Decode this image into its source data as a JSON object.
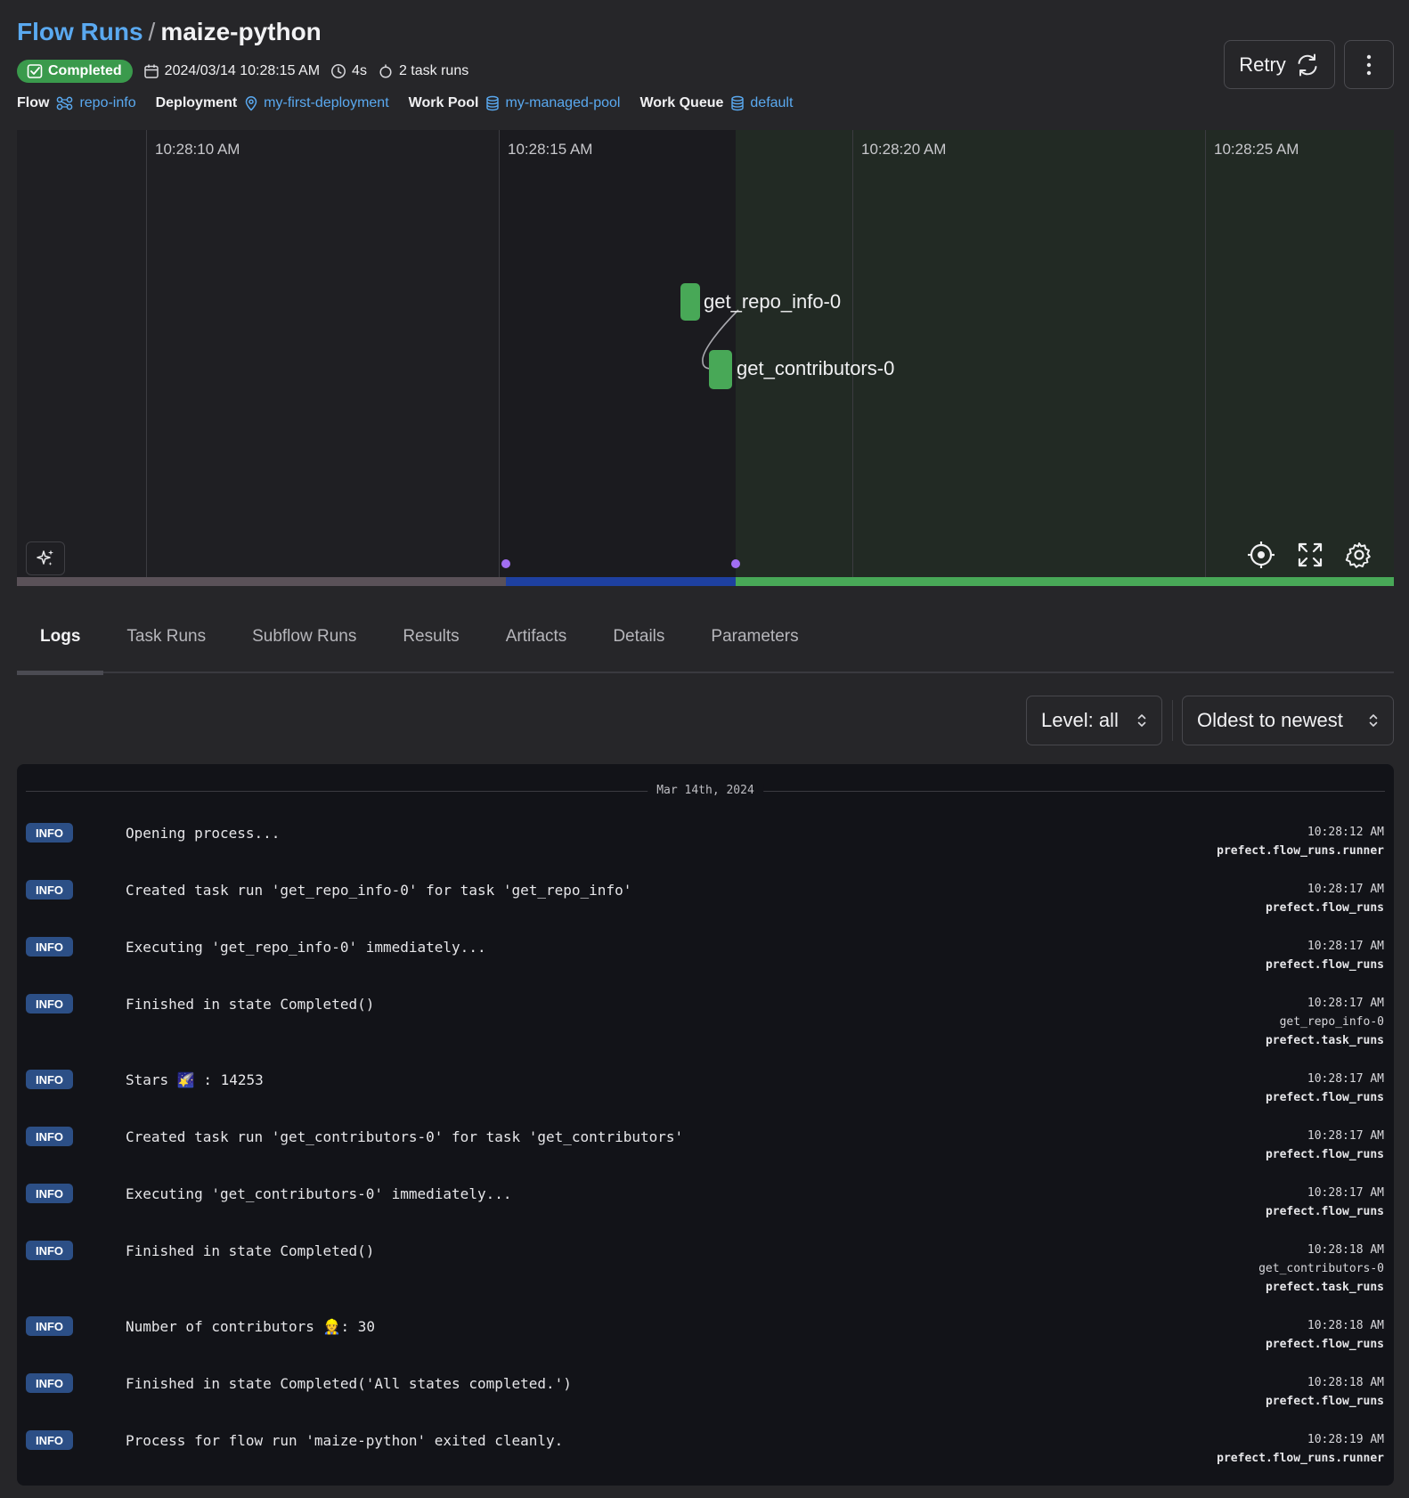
{
  "header": {
    "breadcrumb": "Flow Runs",
    "separator": "/",
    "run_name": "maize-python",
    "state": "Completed",
    "start_time": "2024/03/14 10:28:15 AM",
    "duration": "4s",
    "task_runs": "2 task runs",
    "retry_label": "Retry"
  },
  "info": {
    "flow_label": "Flow",
    "flow_value": "repo-info",
    "deployment_label": "Deployment",
    "deployment_value": "my-first-deployment",
    "work_pool_label": "Work Pool",
    "work_pool_value": "my-managed-pool",
    "work_queue_label": "Work Queue",
    "work_queue_value": "default"
  },
  "timeline": {
    "ticks": [
      "10:28:10 AM",
      "10:28:15 AM",
      "10:28:20 AM",
      "10:28:25 AM"
    ],
    "nodes": [
      "get_repo_info-0",
      "get_contributors-0"
    ]
  },
  "tabs": [
    "Logs",
    "Task Runs",
    "Subflow Runs",
    "Results",
    "Artifacts",
    "Details",
    "Parameters"
  ],
  "filters": {
    "level": "Level: all",
    "sort": "Oldest to newest"
  },
  "logs": {
    "date": "Mar 14th, 2024",
    "entries": [
      {
        "level": "INFO",
        "message": "Opening process...",
        "time": "10:28:12 AM",
        "task": "",
        "source": "prefect.flow_runs.runner"
      },
      {
        "level": "INFO",
        "message": "Created task run 'get_repo_info-0' for task 'get_repo_info'",
        "time": "10:28:17 AM",
        "task": "",
        "source": "prefect.flow_runs"
      },
      {
        "level": "INFO",
        "message": "Executing 'get_repo_info-0' immediately...",
        "time": "10:28:17 AM",
        "task": "",
        "source": "prefect.flow_runs"
      },
      {
        "level": "INFO",
        "message": "Finished in state Completed()",
        "time": "10:28:17 AM",
        "task": "get_repo_info-0",
        "source": "prefect.task_runs"
      },
      {
        "level": "INFO",
        "message": "Stars 🌠 : 14253",
        "time": "10:28:17 AM",
        "task": "",
        "source": "prefect.flow_runs"
      },
      {
        "level": "INFO",
        "message": "Created task run 'get_contributors-0' for task 'get_contributors'",
        "time": "10:28:17 AM",
        "task": "",
        "source": "prefect.flow_runs"
      },
      {
        "level": "INFO",
        "message": "Executing 'get_contributors-0' immediately...",
        "time": "10:28:17 AM",
        "task": "",
        "source": "prefect.flow_runs"
      },
      {
        "level": "INFO",
        "message": "Finished in state Completed()",
        "time": "10:28:18 AM",
        "task": "get_contributors-0",
        "source": "prefect.task_runs"
      },
      {
        "level": "INFO",
        "message": "Number of contributors 👷: 30",
        "time": "10:28:18 AM",
        "task": "",
        "source": "prefect.flow_runs"
      },
      {
        "level": "INFO",
        "message": "Finished in state Completed('All states completed.')",
        "time": "10:28:18 AM",
        "task": "",
        "source": "prefect.flow_runs"
      },
      {
        "level": "INFO",
        "message": "Process for flow run 'maize-python' exited cleanly.",
        "time": "10:28:19 AM",
        "task": "",
        "source": "prefect.flow_runs.runner"
      }
    ]
  },
  "colors": {
    "accent_link": "#5aa9f0",
    "completed": "#3a9a4c",
    "node": "#48a857",
    "scheduled_bar": "#1e40a0",
    "pending_bar": "#5a5158",
    "info_badge": "#2c4f86",
    "marker_dot": "#a16ef2"
  }
}
